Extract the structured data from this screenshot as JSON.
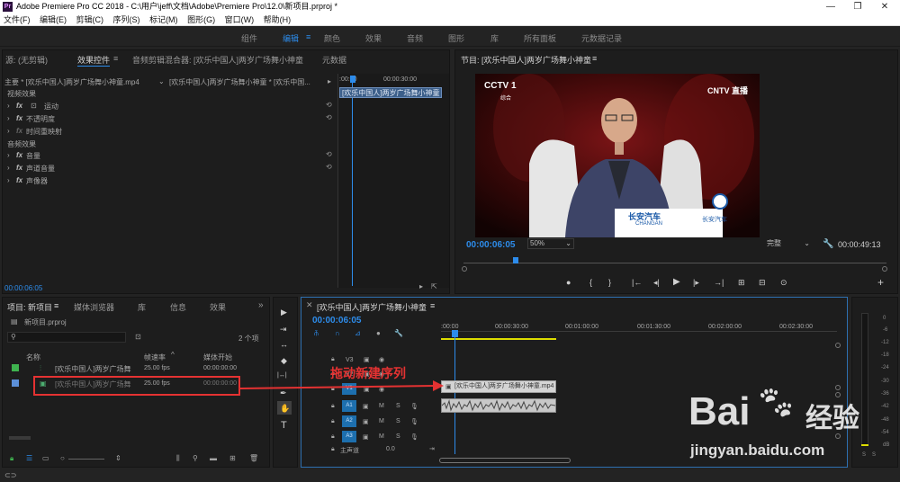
{
  "window": {
    "app_icon": "Pr",
    "title": "Adobe Premiere Pro CC 2018 - C:\\用户\\jeff\\文档\\Adobe\\Premiere Pro\\12.0\\新项目.prproj *",
    "minimize": "—",
    "maximize": "❐",
    "close": "✕"
  },
  "menu": [
    "文件(F)",
    "编辑(E)",
    "剪辑(C)",
    "序列(S)",
    "标记(M)",
    "图形(G)",
    "窗口(W)",
    "帮助(H)"
  ],
  "workspaces": [
    "组件",
    "编辑",
    "颜色",
    "效果",
    "音频",
    "图形",
    "库",
    "所有面板",
    "元数据记录"
  ],
  "workspace_menu": "≡",
  "source_panel": {
    "tabs": [
      "源: (无剪辑)",
      "效果控件",
      "音频剪辑混合器: [欢乐中国人]两岁广场舞小神童",
      "元数据"
    ],
    "tab_menu": "≡",
    "master_label": "主要 * [欢乐中国人]两岁广场舞小神童.mp4",
    "sequence_label": "[欢乐中国人]两岁广场舞小神童 * [欢乐中国...",
    "ruler_start": ":00:00",
    "ruler_end": "00:00:30:00",
    "clip_label": "[欢乐中国人]两岁广场舞小神童",
    "video_effects_header": "视频效果",
    "video_effects": [
      "运动",
      "不透明度",
      "时间重映射"
    ],
    "audio_effects_header": "音频效果",
    "audio_effects": [
      "音量",
      "声道音量",
      "声像器"
    ],
    "fx": "fx",
    "reset_icon": "⟲",
    "timecode": "00:00:06:05"
  },
  "program_panel": {
    "title": "节目: [欢乐中国人]两岁广场舞小神童",
    "title_menu": "≡",
    "timecode": "00:00:06:05",
    "zoom": "50%",
    "quality": "完整",
    "duration": "00:00:49:13",
    "video": {
      "logo_left": "CCTV 1",
      "logo_left_sub": "综合",
      "logo_right": "CNTV 直播",
      "sponsor": "长安汽车",
      "sponsor_en": "CHANGAN"
    },
    "controls": [
      "●",
      "{",
      "}",
      "|←",
      "◂|",
      "▶",
      "|▸",
      "→|",
      "⊞",
      "⊟",
      "⊙"
    ],
    "add_button": "+"
  },
  "project_panel": {
    "tabs": [
      "项目: 新项目",
      "媒体浏览器",
      "库",
      "信息",
      "效果"
    ],
    "tab_menu": "≡",
    "expand": "»",
    "project_file": "新项目.prproj",
    "search_placeholder": "",
    "item_count": "2 个项",
    "columns": [
      "名称",
      "帧速率",
      "媒体开始"
    ],
    "items": [
      {
        "name": "[欢乐中国人]两岁广场舞",
        "fps": "25.00 fps",
        "start": "00:00:00:00",
        "color": "#3fb34f"
      },
      {
        "name": "[欢乐中国人]两岁广场舞",
        "fps": "25.00 fps",
        "start": "00:00:00:00",
        "color": "#5b8fd8"
      }
    ]
  },
  "tools": [
    "▶",
    "⇥",
    "↔",
    "◆",
    "|↔|",
    "✒",
    "✋",
    "T"
  ],
  "timeline": {
    "title": "[欢乐中国人]两岁广场舞小神童",
    "title_menu": "≡",
    "close": "✕",
    "timecode": "00:00:06:05",
    "ruler": [
      ":00:00",
      "00:00:30:00",
      "00:01:00:00",
      "00:01:30:00",
      "00:02:00:00",
      "00:02:30:00"
    ],
    "tracks": {
      "video": [
        "V3",
        "V2",
        "V1"
      ],
      "audio": [
        "A1",
        "A2",
        "A3"
      ],
      "master": "主声道",
      "master_value": "0.0"
    },
    "track_buttons": [
      "M",
      "S"
    ],
    "video_clip": "[欢乐中国人]两岁广场舞小神童.mp4",
    "annotation": "拖动新建序列"
  },
  "meter": {
    "scale": [
      "0",
      "-6",
      "-12",
      "-18",
      "-24",
      "-30",
      "-36",
      "-42",
      "-48",
      "-54",
      "dB"
    ],
    "solo": [
      "S",
      "S"
    ]
  },
  "watermark": {
    "brand": "Bai",
    "brand_cn": "经验",
    "brand_du": "du",
    "url": "jingyan.baidu.com"
  },
  "colors": {
    "accent_blue": "#2d8ceb",
    "annotation_red": "#e53232",
    "audio_track": "#1d6fae",
    "work_area": "#dcdc00"
  }
}
